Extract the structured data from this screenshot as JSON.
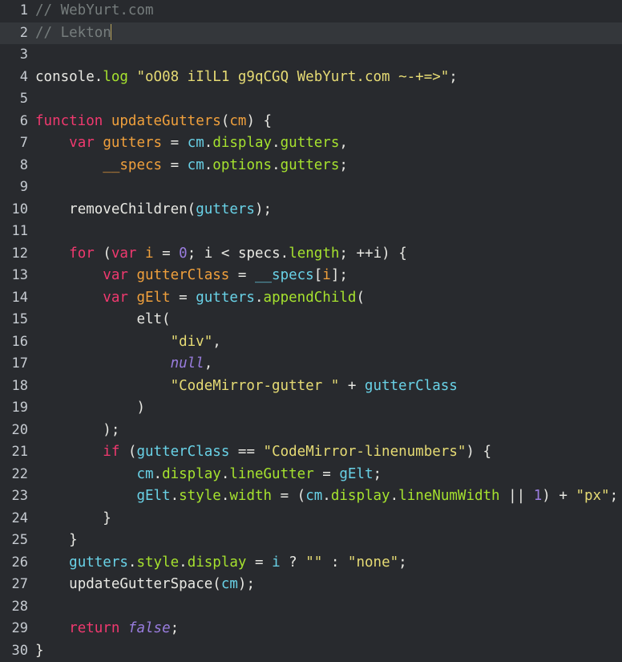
{
  "editor": {
    "name": "code-editor",
    "background_color": "#282a2e",
    "active_line_color": "#34373b",
    "gutter_text_color": "#c6cbd1",
    "default_text_color": "#e8e8e3",
    "cursor_color": "#b9a45a",
    "active_line_number": 2,
    "cursor_line": 2,
    "cursor_column": 10,
    "total_lines": 30,
    "language": "javascript",
    "colors": {
      "comment": "#767d7d",
      "keyword": "#f0396f",
      "definition": "#f0a03c",
      "variable": "#69d2e7",
      "property": "#a6e22e",
      "string": "#e6db74",
      "number": "#9a7ddf",
      "atom": "#9a7ddf"
    }
  },
  "lines": [
    {
      "number": "1",
      "active": false,
      "tokens": [
        {
          "text": "// WebYurt.com",
          "type": "comment"
        }
      ]
    },
    {
      "number": "2",
      "active": true,
      "cursor": true,
      "tokens": [
        {
          "text": "// Lekton",
          "type": "comment"
        }
      ]
    },
    {
      "number": "3",
      "active": false,
      "tokens": []
    },
    {
      "number": "4",
      "active": false,
      "tokens": [
        {
          "text": "console",
          "type": "plain"
        },
        {
          "text": ".",
          "type": "plain"
        },
        {
          "text": "log",
          "type": "prop"
        },
        {
          "text": " ",
          "type": "plain"
        },
        {
          "text": "\"oO08 iIlL1 g9qCGQ WebYurt.com ~-+=>\"",
          "type": "string"
        },
        {
          "text": ";",
          "type": "plain"
        }
      ]
    },
    {
      "number": "5",
      "active": false,
      "tokens": []
    },
    {
      "number": "6",
      "active": false,
      "tokens": [
        {
          "text": "function",
          "type": "keyword"
        },
        {
          "text": " ",
          "type": "plain"
        },
        {
          "text": "updateGutters",
          "type": "def"
        },
        {
          "text": "(",
          "type": "bracket"
        },
        {
          "text": "cm",
          "type": "def"
        },
        {
          "text": ")",
          "type": "bracket"
        },
        {
          "text": " {",
          "type": "plain"
        }
      ]
    },
    {
      "number": "7",
      "active": false,
      "tokens": [
        {
          "text": "    ",
          "type": "plain"
        },
        {
          "text": "var",
          "type": "keyword"
        },
        {
          "text": " ",
          "type": "plain"
        },
        {
          "text": "gutters",
          "type": "def"
        },
        {
          "text": " = ",
          "type": "op"
        },
        {
          "text": "cm",
          "type": "var"
        },
        {
          "text": ".",
          "type": "plain"
        },
        {
          "text": "display",
          "type": "prop"
        },
        {
          "text": ".",
          "type": "plain"
        },
        {
          "text": "gutters",
          "type": "prop"
        },
        {
          "text": ",",
          "type": "plain"
        }
      ]
    },
    {
      "number": "8",
      "active": false,
      "tokens": [
        {
          "text": "        ",
          "type": "plain"
        },
        {
          "text": "__specs",
          "type": "def"
        },
        {
          "text": " = ",
          "type": "op"
        },
        {
          "text": "cm",
          "type": "var"
        },
        {
          "text": ".",
          "type": "plain"
        },
        {
          "text": "options",
          "type": "prop"
        },
        {
          "text": ".",
          "type": "plain"
        },
        {
          "text": "gutters",
          "type": "prop"
        },
        {
          "text": ";",
          "type": "plain"
        }
      ]
    },
    {
      "number": "9",
      "active": false,
      "tokens": []
    },
    {
      "number": "10",
      "active": false,
      "tokens": [
        {
          "text": "    ",
          "type": "plain"
        },
        {
          "text": "removeChildren",
          "type": "plain"
        },
        {
          "text": "(",
          "type": "bracket"
        },
        {
          "text": "gutters",
          "type": "var"
        },
        {
          "text": ")",
          "type": "bracket"
        },
        {
          "text": ";",
          "type": "plain"
        }
      ]
    },
    {
      "number": "11",
      "active": false,
      "tokens": []
    },
    {
      "number": "12",
      "active": false,
      "tokens": [
        {
          "text": "    ",
          "type": "plain"
        },
        {
          "text": "for",
          "type": "keyword"
        },
        {
          "text": " ",
          "type": "plain"
        },
        {
          "text": "(",
          "type": "bracket"
        },
        {
          "text": "var",
          "type": "keyword"
        },
        {
          "text": " ",
          "type": "plain"
        },
        {
          "text": "i",
          "type": "def"
        },
        {
          "text": " = ",
          "type": "op"
        },
        {
          "text": "0",
          "type": "number"
        },
        {
          "text": "; ",
          "type": "plain"
        },
        {
          "text": "i",
          "type": "plain"
        },
        {
          "text": " < ",
          "type": "op"
        },
        {
          "text": "specs",
          "type": "plain"
        },
        {
          "text": ".",
          "type": "plain"
        },
        {
          "text": "length",
          "type": "prop"
        },
        {
          "text": "; ",
          "type": "plain"
        },
        {
          "text": "++",
          "type": "op"
        },
        {
          "text": "i",
          "type": "plain"
        },
        {
          "text": ")",
          "type": "bracket"
        },
        {
          "text": " {",
          "type": "plain"
        }
      ]
    },
    {
      "number": "13",
      "active": false,
      "tokens": [
        {
          "text": "        ",
          "type": "plain"
        },
        {
          "text": "var",
          "type": "keyword"
        },
        {
          "text": " ",
          "type": "plain"
        },
        {
          "text": "gutterClass",
          "type": "def"
        },
        {
          "text": " = ",
          "type": "op"
        },
        {
          "text": "__specs",
          "type": "var"
        },
        {
          "text": "[",
          "type": "bracket"
        },
        {
          "text": "i",
          "type": "def"
        },
        {
          "text": "]",
          "type": "bracket"
        },
        {
          "text": ";",
          "type": "plain"
        }
      ]
    },
    {
      "number": "14",
      "active": false,
      "tokens": [
        {
          "text": "        ",
          "type": "plain"
        },
        {
          "text": "var",
          "type": "keyword"
        },
        {
          "text": " ",
          "type": "plain"
        },
        {
          "text": "gElt",
          "type": "def"
        },
        {
          "text": " = ",
          "type": "op"
        },
        {
          "text": "gutters",
          "type": "var"
        },
        {
          "text": ".",
          "type": "plain"
        },
        {
          "text": "appendChild",
          "type": "prop"
        },
        {
          "text": "(",
          "type": "bracket"
        }
      ]
    },
    {
      "number": "15",
      "active": false,
      "tokens": [
        {
          "text": "            ",
          "type": "plain"
        },
        {
          "text": "elt",
          "type": "plain"
        },
        {
          "text": "(",
          "type": "bracket"
        }
      ]
    },
    {
      "number": "16",
      "active": false,
      "tokens": [
        {
          "text": "                ",
          "type": "plain"
        },
        {
          "text": "\"div\"",
          "type": "string"
        },
        {
          "text": ",",
          "type": "plain"
        }
      ]
    },
    {
      "number": "17",
      "active": false,
      "tokens": [
        {
          "text": "                ",
          "type": "plain"
        },
        {
          "text": "null",
          "type": "atom"
        },
        {
          "text": ",",
          "type": "plain"
        }
      ]
    },
    {
      "number": "18",
      "active": false,
      "tokens": [
        {
          "text": "                ",
          "type": "plain"
        },
        {
          "text": "\"CodeMirror-gutter \"",
          "type": "string"
        },
        {
          "text": " + ",
          "type": "op"
        },
        {
          "text": "gutterClass",
          "type": "var"
        }
      ]
    },
    {
      "number": "19",
      "active": false,
      "tokens": [
        {
          "text": "            ",
          "type": "plain"
        },
        {
          "text": ")",
          "type": "bracket"
        }
      ]
    },
    {
      "number": "20",
      "active": false,
      "tokens": [
        {
          "text": "        ",
          "type": "plain"
        },
        {
          "text": ")",
          "type": "bracket"
        },
        {
          "text": ";",
          "type": "plain"
        }
      ]
    },
    {
      "number": "21",
      "active": false,
      "tokens": [
        {
          "text": "        ",
          "type": "plain"
        },
        {
          "text": "if",
          "type": "keyword"
        },
        {
          "text": " ",
          "type": "plain"
        },
        {
          "text": "(",
          "type": "bracket"
        },
        {
          "text": "gutterClass",
          "type": "var"
        },
        {
          "text": " == ",
          "type": "op"
        },
        {
          "text": "\"CodeMirror-linenumbers\"",
          "type": "string"
        },
        {
          "text": ")",
          "type": "bracket"
        },
        {
          "text": " {",
          "type": "plain"
        }
      ]
    },
    {
      "number": "22",
      "active": false,
      "tokens": [
        {
          "text": "            ",
          "type": "plain"
        },
        {
          "text": "cm",
          "type": "var"
        },
        {
          "text": ".",
          "type": "plain"
        },
        {
          "text": "display",
          "type": "prop"
        },
        {
          "text": ".",
          "type": "plain"
        },
        {
          "text": "lineGutter",
          "type": "prop"
        },
        {
          "text": " = ",
          "type": "op"
        },
        {
          "text": "gElt",
          "type": "var"
        },
        {
          "text": ";",
          "type": "plain"
        }
      ]
    },
    {
      "number": "23",
      "active": false,
      "tokens": [
        {
          "text": "            ",
          "type": "plain"
        },
        {
          "text": "gElt",
          "type": "var"
        },
        {
          "text": ".",
          "type": "plain"
        },
        {
          "text": "style",
          "type": "prop"
        },
        {
          "text": ".",
          "type": "plain"
        },
        {
          "text": "width",
          "type": "prop"
        },
        {
          "text": " = ",
          "type": "op"
        },
        {
          "text": "(",
          "type": "bracket"
        },
        {
          "text": "cm",
          "type": "var"
        },
        {
          "text": ".",
          "type": "plain"
        },
        {
          "text": "display",
          "type": "prop"
        },
        {
          "text": ".",
          "type": "plain"
        },
        {
          "text": "lineNumWidth",
          "type": "prop"
        },
        {
          "text": " || ",
          "type": "op"
        },
        {
          "text": "1",
          "type": "number"
        },
        {
          "text": ")",
          "type": "bracket"
        },
        {
          "text": " + ",
          "type": "op"
        },
        {
          "text": "\"px\"",
          "type": "string"
        },
        {
          "text": ";",
          "type": "plain"
        }
      ]
    },
    {
      "number": "24",
      "active": false,
      "tokens": [
        {
          "text": "        }",
          "type": "plain"
        }
      ]
    },
    {
      "number": "25",
      "active": false,
      "tokens": [
        {
          "text": "    }",
          "type": "plain"
        }
      ]
    },
    {
      "number": "26",
      "active": false,
      "tokens": [
        {
          "text": "    ",
          "type": "plain"
        },
        {
          "text": "gutters",
          "type": "var"
        },
        {
          "text": ".",
          "type": "plain"
        },
        {
          "text": "style",
          "type": "prop"
        },
        {
          "text": ".",
          "type": "plain"
        },
        {
          "text": "display",
          "type": "prop"
        },
        {
          "text": " = ",
          "type": "op"
        },
        {
          "text": "i",
          "type": "var"
        },
        {
          "text": " ? ",
          "type": "op"
        },
        {
          "text": "\"\"",
          "type": "string"
        },
        {
          "text": " : ",
          "type": "op"
        },
        {
          "text": "\"none\"",
          "type": "string"
        },
        {
          "text": ";",
          "type": "plain"
        }
      ]
    },
    {
      "number": "27",
      "active": false,
      "tokens": [
        {
          "text": "    ",
          "type": "plain"
        },
        {
          "text": "updateGutterSpace",
          "type": "plain"
        },
        {
          "text": "(",
          "type": "bracket"
        },
        {
          "text": "cm",
          "type": "var"
        },
        {
          "text": ")",
          "type": "bracket"
        },
        {
          "text": ";",
          "type": "plain"
        }
      ]
    },
    {
      "number": "28",
      "active": false,
      "tokens": []
    },
    {
      "number": "29",
      "active": false,
      "tokens": [
        {
          "text": "    ",
          "type": "plain"
        },
        {
          "text": "return",
          "type": "keyword"
        },
        {
          "text": " ",
          "type": "plain"
        },
        {
          "text": "false",
          "type": "atom"
        },
        {
          "text": ";",
          "type": "plain"
        }
      ]
    },
    {
      "number": "30",
      "active": false,
      "tokens": [
        {
          "text": "}",
          "type": "plain"
        }
      ]
    }
  ]
}
